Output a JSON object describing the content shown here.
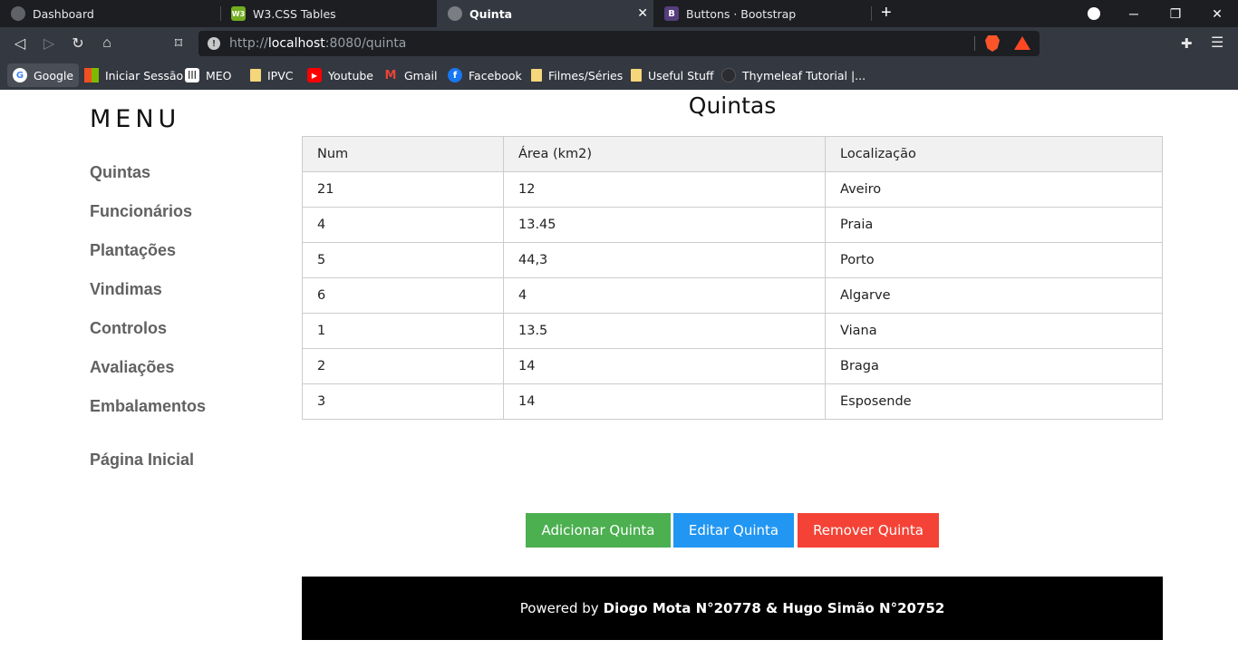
{
  "browser": {
    "tabs": [
      {
        "title": "Dashboard"
      },
      {
        "title": "W3.CSS Tables",
        "icon_text": "W3"
      },
      {
        "title": "Quinta",
        "active": true
      },
      {
        "title": "Buttons · Bootstrap",
        "icon_text": "B"
      }
    ],
    "new_tab": "+",
    "url_scheme_host": "http://",
    "url_host": "localhost",
    "url_rest": ":8080/quinta",
    "bookmarks": [
      {
        "label": "Google",
        "icon": "google-icon"
      },
      {
        "label": "Iniciar Sessão",
        "icon": "microsoft-icon"
      },
      {
        "label": "MEO",
        "icon": "meo-icon"
      },
      {
        "label": "IPVC",
        "icon": "folder-icon"
      },
      {
        "label": "Youtube",
        "icon": "youtube-icon"
      },
      {
        "label": "Gmail",
        "icon": "gmail-icon"
      },
      {
        "label": "Facebook",
        "icon": "facebook-icon"
      },
      {
        "label": "Filmes/Séries",
        "icon": "folder-icon"
      },
      {
        "label": "Useful Stuff",
        "icon": "folder-icon"
      },
      {
        "label": "Thymeleaf Tutorial |...",
        "icon": "thymeleaf-icon"
      }
    ]
  },
  "sidebar": {
    "title": "MENU",
    "links": [
      "Quintas",
      "Funcionários",
      "Plantações",
      "Vindimas",
      "Controlos",
      "Avaliações",
      "Embalamentos"
    ],
    "home": "Página Inicial"
  },
  "main": {
    "title": "Quintas",
    "columns": [
      "Num",
      "Área (km2)",
      "Localização"
    ],
    "rows": [
      [
        "21",
        "12",
        "Aveiro"
      ],
      [
        "4",
        "13.45",
        "Praia"
      ],
      [
        "5",
        "44,3",
        "Porto"
      ],
      [
        "6",
        "4",
        "Algarve"
      ],
      [
        "1",
        "13.5",
        "Viana"
      ],
      [
        "2",
        "14",
        "Braga"
      ],
      [
        "3",
        "14",
        "Esposende"
      ]
    ]
  },
  "actions": {
    "add": "Adicionar Quinta",
    "edit": "Editar Quinta",
    "remove": "Remover Quinta"
  },
  "footer": {
    "prefix": "Powered by",
    "authors": "Diogo Mota N°20778 & Hugo Simão N°20752"
  },
  "colors": {
    "add": "#4caf50",
    "edit": "#2196f3",
    "remove": "#f44336",
    "footer_bg": "#000000",
    "table_header_bg": "#f1f1f1"
  }
}
